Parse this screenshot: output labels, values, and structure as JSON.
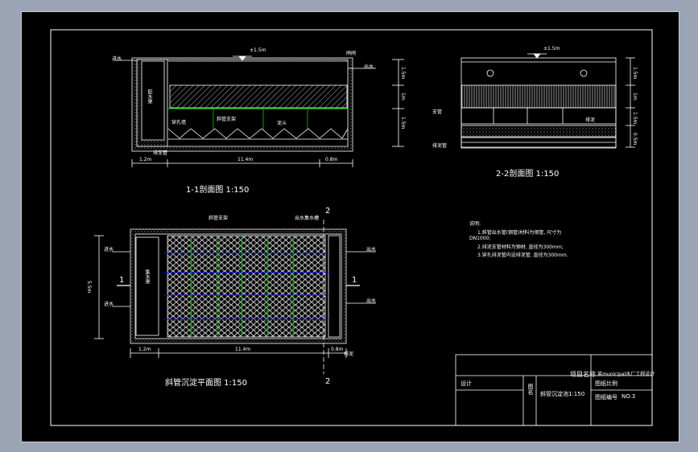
{
  "colors": {
    "background": "#000000",
    "frame": "#9aa4b4",
    "lines": "#ffffff",
    "pipe": "#0000ff",
    "grid": "#00c800"
  },
  "section_1_1": {
    "title": "1-1剖面图  1:150",
    "water_level": "±1.5m",
    "inlet": "进水",
    "outlet": "出水",
    "valve": "闸阀",
    "perf_wall": "穿孔墙",
    "tube_label": "斜管支架",
    "sludge_label": "排泥管",
    "channel_label": "配水渠",
    "hopper_label": "泥斗",
    "dims_right": [
      "1.5m",
      "1m",
      "1.5m"
    ],
    "dims_bottom": [
      "1.2m",
      "11.4m",
      "0.8m"
    ]
  },
  "section_2_2": {
    "title": "2-2剖面图  1:150",
    "water_level": "±1.5m",
    "left_label": "支管",
    "right_label": "排泥",
    "bottom_label": "排泥管",
    "dims_right": [
      "1.5m",
      "1m",
      "1.5m",
      "0.5m"
    ]
  },
  "plan": {
    "title": "斜管沉淀平面图  1:150",
    "top_label_a": "斜管支架",
    "top_label_b": "出水集水槽",
    "channel_label": "集水渠",
    "inlet": "进水",
    "outlet": "出水",
    "sludge": "排泥",
    "marker_1": "1",
    "marker_2": "2",
    "dim_left": "5.5m",
    "dims_bottom": [
      "1.2m",
      "11.4m",
      "0.8m"
    ]
  },
  "notes": {
    "title": "说明:",
    "lines": [
      "1.斜管出水管(钢管)材料为钢管, 尺寸为",
      "DN1000;",
      "2.排泥支管材料为钢材, 直径为300mm;",
      "3.穿孔排泥管内设排泥管, 直径为300mm."
    ]
  },
  "title_block": {
    "project_label": "项目名称",
    "project_value": "某municipal水厂工程设计",
    "design": "设计",
    "drawing_name_label": "图名",
    "drawing_name": "斜管沉淀池1:150",
    "scale_label": "图纸比例",
    "number_label": "图纸编号",
    "number_value": "NO.3"
  }
}
